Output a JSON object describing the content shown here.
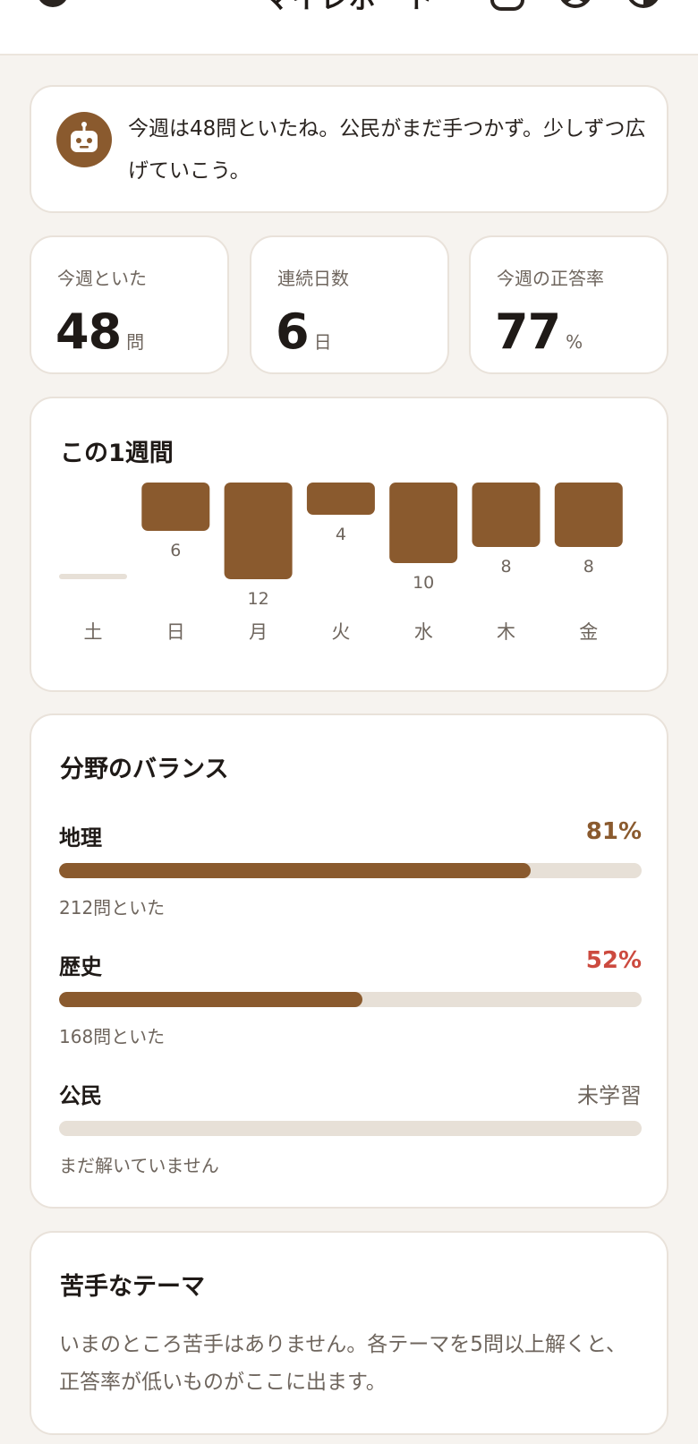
{
  "header": {
    "title": "マイレポート",
    "back_icon": "back-icon",
    "icons": [
      "book-icon",
      "profile-icon",
      "theme-icon"
    ]
  },
  "coach": {
    "avatar_icon": "robot-icon",
    "message": "今週は48問といたね。公民がまだ手つかず。少しずつ広げていこう。"
  },
  "stats": [
    {
      "label": "今週といた",
      "value": "48",
      "unit": "問"
    },
    {
      "label": "連続日数",
      "value": "6",
      "unit": "日"
    },
    {
      "label": "今週の正答率",
      "value": "77",
      "unit": "%"
    }
  ],
  "weekly": {
    "title": "この1週間",
    "chart_data": {
      "type": "bar",
      "categories": [
        "土",
        "日",
        "月",
        "火",
        "水",
        "木",
        "金"
      ],
      "values": [
        0,
        6,
        12,
        4,
        10,
        8,
        8
      ],
      "value_labels": [
        "",
        "6",
        "12",
        "4",
        "10",
        "8",
        "8"
      ],
      "color": "#8a5a2e",
      "empty_color": "#e7e0d7"
    }
  },
  "balance": {
    "title": "分野のバランス",
    "subjects": [
      {
        "name": "地理",
        "percent": 81,
        "percent_text": "81%",
        "pct_color": "#8a5a2e",
        "sub": "212問といた"
      },
      {
        "name": "歴史",
        "percent": 52,
        "percent_text": "52%",
        "pct_color": "#cc4a3f",
        "sub": "168問といた"
      },
      {
        "name": "公民",
        "percent": 0,
        "status": "未学習",
        "sub": "まだ解いていません"
      }
    ]
  },
  "weak": {
    "title": "苦手なテーマ",
    "text": "いまのところ苦手はありません。各テーマを5問以上解くと、正答率が低いものがここに出ます。"
  },
  "colors": {
    "accent": "#8a5a2e",
    "danger": "#cc4a3f",
    "background": "#f6f3ef",
    "track": "#e7e0d7"
  }
}
